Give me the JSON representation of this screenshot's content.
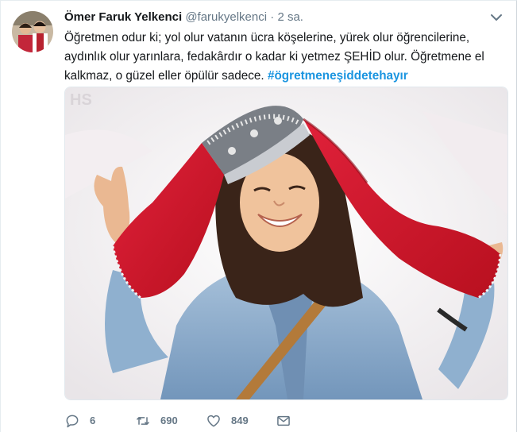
{
  "tweet": {
    "user": {
      "display_name": "Ömer Faruk Yelkenci",
      "handle": "@farukyelkenci",
      "separator": "·",
      "time": "2 sa."
    },
    "text": "Öğretmen odur ki; yol olur vatanın ücra köşelerine, yürek olur öğrencilerine, aydınlık olur yarınlara, fedakârdır o kadar ki yetmez ŞEHİD olur. Öğretmene el kalkmaz, o güzel eller öpülür sadece. ",
    "hashtag": "#ögretmeneşiddetehayır",
    "media": {
      "watermark": "HS",
      "colors": {
        "scarf": "#d8172b",
        "denim": "#8fb0cf",
        "background": "#f1eff1"
      }
    },
    "actions": {
      "reply": {
        "icon": "reply-icon",
        "count": "6"
      },
      "retweet": {
        "icon": "retweet-icon",
        "count": "690"
      },
      "like": {
        "icon": "heart-icon",
        "count": "849"
      },
      "message": {
        "icon": "envelope-icon"
      }
    },
    "menu": {
      "icon": "chevron-down-icon"
    }
  }
}
